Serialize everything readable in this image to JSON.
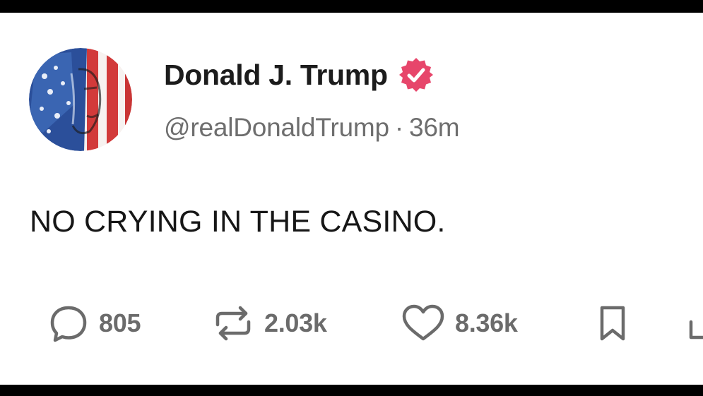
{
  "post": {
    "author": {
      "display_name": "Donald J. Trump",
      "handle": "@realDonaldTrump",
      "verified": true,
      "avatar_icon": "flag-portrait-avatar"
    },
    "time_separator": "·",
    "timestamp": "36m",
    "text": "NO CRYING IN THE CASINO.",
    "actions": {
      "reply": {
        "icon": "reply-bubble-icon",
        "count": "805"
      },
      "repost": {
        "icon": "repost-icon",
        "count": "2.03k"
      },
      "like": {
        "icon": "heart-icon",
        "count": "8.36k"
      },
      "bookmark": {
        "icon": "bookmark-icon"
      },
      "share": {
        "icon": "share-icon"
      }
    }
  },
  "colors": {
    "background": "#ffffff",
    "frame_bars": "#000000",
    "verified_badge": "#e7466b",
    "muted_text": "#6e6e6e",
    "primary_text": "#1c1c1c"
  }
}
